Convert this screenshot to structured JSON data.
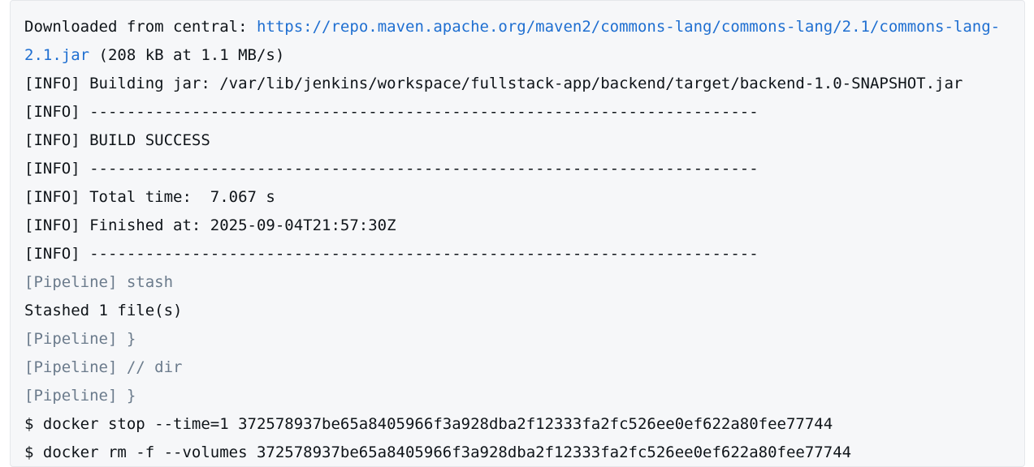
{
  "console_log": {
    "lines": [
      {
        "prefix": "Downloaded from central: ",
        "link_text": "https://repo.maven.apache.org/maven2/commons-lang/commons-lang/2.1/commons-lang-"
      },
      {
        "link_text": "2.1.jar",
        "suffix": " (208 kB at 1.1 MB/s)"
      },
      {
        "text": "[INFO] Building jar: /var/lib/jenkins/workspace/fullstack-app/backend/target/backend-1.0-SNAPSHOT.jar"
      },
      {
        "text": "[INFO] ------------------------------------------------------------------------"
      },
      {
        "text": "[INFO] BUILD SUCCESS"
      },
      {
        "text": "[INFO] ------------------------------------------------------------------------"
      },
      {
        "text": "[INFO] Total time:  7.067 s"
      },
      {
        "text": "[INFO] Finished at: 2025-09-04T21:57:30Z"
      },
      {
        "text": "[INFO] ------------------------------------------------------------------------"
      },
      {
        "text": "[Pipeline] stash"
      },
      {
        "text": "Stashed 1 file(s)"
      },
      {
        "text": "[Pipeline] }"
      },
      {
        "text": "[Pipeline] // dir"
      },
      {
        "text": "[Pipeline] }"
      },
      {
        "text": "$ docker stop --time=1 372578937be65a8405966f3a928dba2f12333fa2fc526ee0ef622a80fee77744"
      },
      {
        "text": "$ docker rm -f --volumes 372578937be65a8405966f3a928dba2f12333fa2fc526ee0ef622a80fee77744"
      }
    ]
  }
}
